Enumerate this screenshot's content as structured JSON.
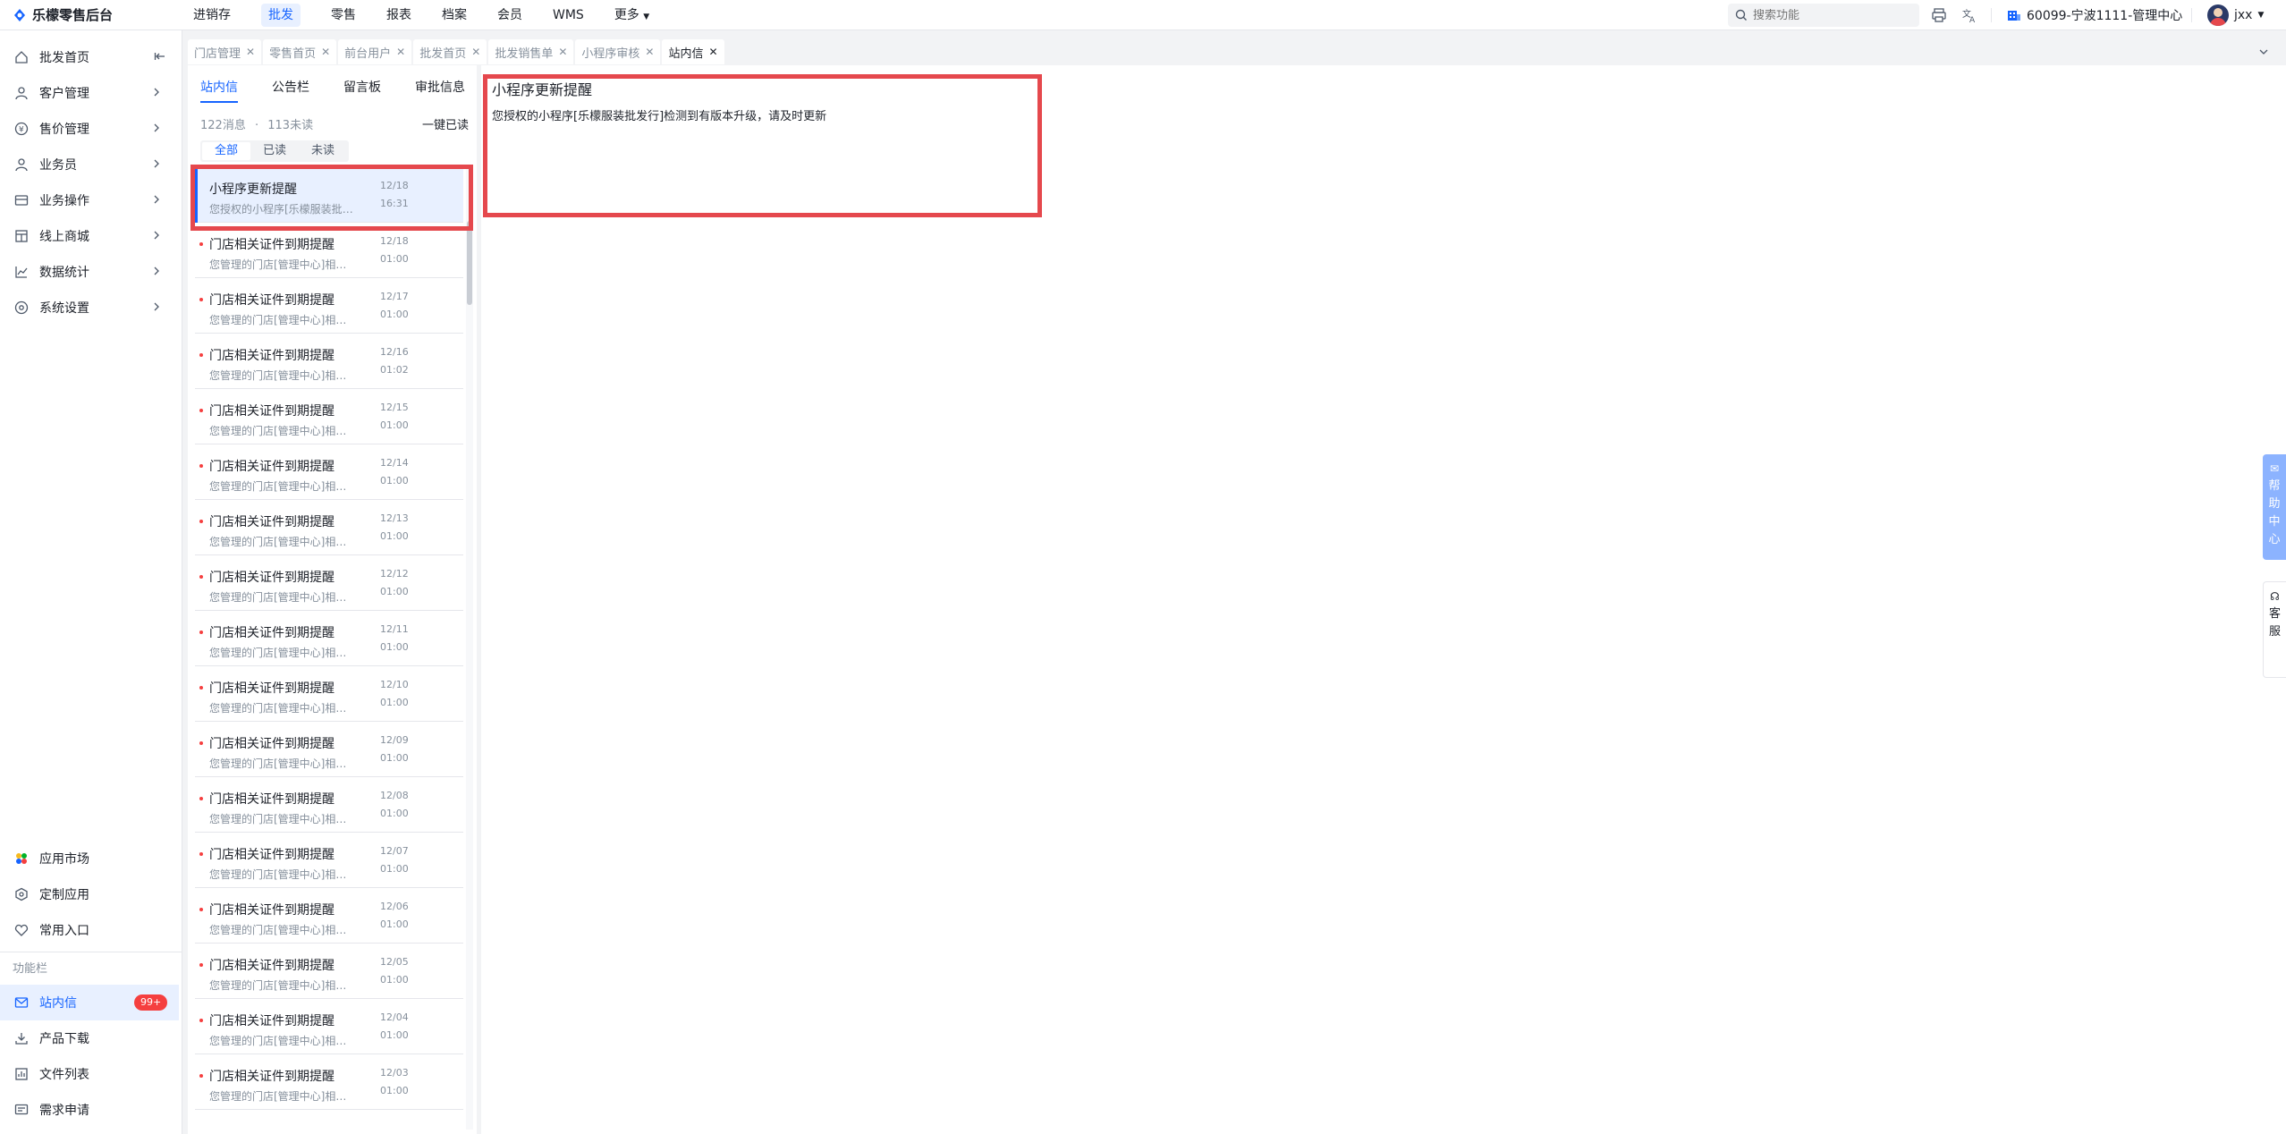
{
  "app": {
    "title": "乐檬零售后台"
  },
  "topnav": [
    {
      "label": "进销存",
      "active": false
    },
    {
      "label": "批发",
      "active": true
    },
    {
      "label": "零售",
      "active": false
    },
    {
      "label": "报表",
      "active": false
    },
    {
      "label": "档案",
      "active": false
    },
    {
      "label": "会员",
      "active": false
    },
    {
      "label": "WMS",
      "active": false
    },
    {
      "label": "更多",
      "active": false
    }
  ],
  "search": {
    "placeholder": "搜索功能"
  },
  "org": {
    "label": "60099-宁波1111-管理中心"
  },
  "user": {
    "name": "jxx"
  },
  "sidebar": {
    "items": [
      {
        "label": "批发首页",
        "icon": "home-icon"
      },
      {
        "label": "客户管理",
        "icon": "user-icon"
      },
      {
        "label": "售价管理",
        "icon": "price-icon"
      },
      {
        "label": "业务员",
        "icon": "user-icon"
      },
      {
        "label": "业务操作",
        "icon": "operation-icon"
      },
      {
        "label": "线上商城",
        "icon": "store-icon"
      },
      {
        "label": "数据统计",
        "icon": "chart-icon"
      },
      {
        "label": "系统设置",
        "icon": "settings-icon"
      }
    ],
    "bottom": [
      {
        "label": "应用市场",
        "icon": "app-market-icon"
      },
      {
        "label": "定制应用",
        "icon": "custom-app-icon"
      },
      {
        "label": "常用入口",
        "icon": "heart-icon"
      }
    ],
    "section_label": "功能栏",
    "func": [
      {
        "label": "站内信",
        "icon": "mail-icon",
        "badge": "99+",
        "active": true
      },
      {
        "label": "产品下载",
        "icon": "download-icon"
      },
      {
        "label": "文件列表",
        "icon": "file-list-icon"
      },
      {
        "label": "需求申请",
        "icon": "request-icon"
      }
    ]
  },
  "tabs": [
    {
      "label": "门店管理",
      "active": false
    },
    {
      "label": "零售首页",
      "active": false
    },
    {
      "label": "前台用户",
      "active": false
    },
    {
      "label": "批发首页",
      "active": false
    },
    {
      "label": "批发销售单",
      "active": false
    },
    {
      "label": "小程序审核",
      "active": false
    },
    {
      "label": "站内信",
      "active": true
    }
  ],
  "messages_panel": {
    "tabs": [
      "站内信",
      "公告栏",
      "留言板",
      "审批信息"
    ],
    "count_total": "122消息",
    "sep": "·",
    "count_unread": "113未读",
    "mark_all": "一键已读",
    "filters": [
      "全部",
      "已读",
      "未读"
    ]
  },
  "messages": [
    {
      "title": "小程序更新提醒",
      "preview": "您授权的小程序[乐檬服装批发行]检测到有版本升级，请及时更新",
      "date": "12/18",
      "time": "16:31",
      "selected": true
    },
    {
      "title": "门店相关证件到期提醒",
      "preview": "您管理的门店[管理中心]相关证件即将到期",
      "date": "12/18",
      "time": "01:00"
    },
    {
      "title": "门店相关证件到期提醒",
      "preview": "您管理的门店[管理中心]相关证件即将到期",
      "date": "12/17",
      "time": "01:00"
    },
    {
      "title": "门店相关证件到期提醒",
      "preview": "您管理的门店[管理中心]相关证件即将到期",
      "date": "12/16",
      "time": "01:02"
    },
    {
      "title": "门店相关证件到期提醒",
      "preview": "您管理的门店[管理中心]相关证件即将到期",
      "date": "12/15",
      "time": "01:00"
    },
    {
      "title": "门店相关证件到期提醒",
      "preview": "您管理的门店[管理中心]相关证件即将到期",
      "date": "12/14",
      "time": "01:00"
    },
    {
      "title": "门店相关证件到期提醒",
      "preview": "您管理的门店[管理中心]相关证件即将到期",
      "date": "12/13",
      "time": "01:00"
    },
    {
      "title": "门店相关证件到期提醒",
      "preview": "您管理的门店[管理中心]相关证件即将到期",
      "date": "12/12",
      "time": "01:00"
    },
    {
      "title": "门店相关证件到期提醒",
      "preview": "您管理的门店[管理中心]相关证件即将到期",
      "date": "12/11",
      "time": "01:00"
    },
    {
      "title": "门店相关证件到期提醒",
      "preview": "您管理的门店[管理中心]相关证件即将到期",
      "date": "12/10",
      "time": "01:00"
    },
    {
      "title": "门店相关证件到期提醒",
      "preview": "您管理的门店[管理中心]相关证件即将到期",
      "date": "12/09",
      "time": "01:00"
    },
    {
      "title": "门店相关证件到期提醒",
      "preview": "您管理的门店[管理中心]相关证件即将到期",
      "date": "12/08",
      "time": "01:00"
    },
    {
      "title": "门店相关证件到期提醒",
      "preview": "您管理的门店[管理中心]相关证件即将到期",
      "date": "12/07",
      "time": "01:00"
    },
    {
      "title": "门店相关证件到期提醒",
      "preview": "您管理的门店[管理中心]相关证件即将到期",
      "date": "12/06",
      "time": "01:00"
    },
    {
      "title": "门店相关证件到期提醒",
      "preview": "您管理的门店[管理中心]相关证件即将到期",
      "date": "12/05",
      "time": "01:00"
    },
    {
      "title": "门店相关证件到期提醒",
      "preview": "您管理的门店[管理中心]相关证件即将到期",
      "date": "12/04",
      "time": "01:00"
    },
    {
      "title": "门店相关证件到期提醒",
      "preview": "您管理的门店[管理中心]相关证件即将到期",
      "date": "12/03",
      "time": "01:00"
    }
  ],
  "detail": {
    "title": "小程序更新提醒",
    "body": "您授权的小程序[乐檬服装批发行]检测到有版本升级，请及时更新"
  },
  "float": {
    "help": "帮助中心",
    "service": "客服"
  },
  "colors": {
    "accent": "#1664ff",
    "highlight_box": "#e5484d",
    "badge": "#f53f3f"
  }
}
